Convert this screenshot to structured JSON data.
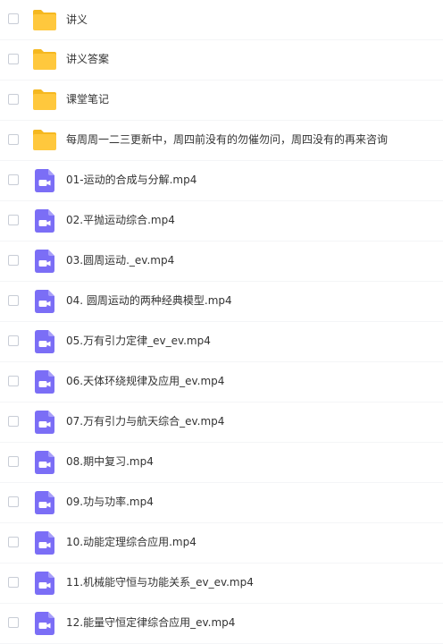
{
  "colors": {
    "folder": "#ffc83d",
    "folder_tab": "#f5b820",
    "video": "#7b6ef6",
    "text": "#333333",
    "checkbox_border": "#c8cdd6"
  },
  "files": [
    {
      "name": "讲义",
      "icon": "folder-icon",
      "type": "folder"
    },
    {
      "name": "讲义答案",
      "icon": "folder-icon",
      "type": "folder"
    },
    {
      "name": "课堂笔记",
      "icon": "folder-icon",
      "type": "folder"
    },
    {
      "name": "每周周一二三更新中，周四前没有的勿催勿问，周四没有的再来咨询",
      "icon": "folder-icon",
      "type": "folder"
    },
    {
      "name": "01-运动的合成与分解.mp4",
      "icon": "video-file-icon",
      "type": "video"
    },
    {
      "name": "02.平抛运动综合.mp4",
      "icon": "video-file-icon",
      "type": "video"
    },
    {
      "name": "03.圆周运动._ev.mp4",
      "icon": "video-file-icon",
      "type": "video"
    },
    {
      "name": "04. 圆周运动的两种经典模型.mp4",
      "icon": "video-file-icon",
      "type": "video"
    },
    {
      "name": "05.万有引力定律_ev_ev.mp4",
      "icon": "video-file-icon",
      "type": "video"
    },
    {
      "name": "06.天体环绕规律及应用_ev.mp4",
      "icon": "video-file-icon",
      "type": "video"
    },
    {
      "name": "07.万有引力与航天综合_ev.mp4",
      "icon": "video-file-icon",
      "type": "video"
    },
    {
      "name": "08.期中复习.mp4",
      "icon": "video-file-icon",
      "type": "video"
    },
    {
      "name": "09.功与功率.mp4",
      "icon": "video-file-icon",
      "type": "video"
    },
    {
      "name": "10.动能定理综合应用.mp4",
      "icon": "video-file-icon",
      "type": "video"
    },
    {
      "name": "11.机械能守恒与功能关系_ev_ev.mp4",
      "icon": "video-file-icon",
      "type": "video"
    },
    {
      "name": "12.能量守恒定律综合应用_ev.mp4",
      "icon": "video-file-icon",
      "type": "video"
    }
  ]
}
